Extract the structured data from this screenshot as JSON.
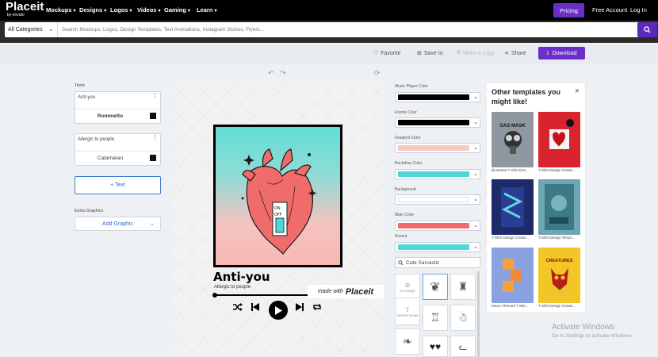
{
  "nav": {
    "logo": "Placeit",
    "logo_sub": "by envato",
    "items": [
      "Mockups",
      "Designs",
      "Logos",
      "Videos",
      "Gaming",
      "Learn"
    ],
    "pricing": "Pricing",
    "create_account": "Free Account",
    "login": "Log In"
  },
  "search": {
    "category": "All Categories",
    "placeholder": "Search Mockups, Logos, Design Templates, Text Animations, Instagram Stories, Flyers..."
  },
  "actions": {
    "favorite": "Favorite",
    "save": "Save to",
    "copy": "Make a copy",
    "share": "Share",
    "download": "Download"
  },
  "left": {
    "texts_label": "Texts",
    "text1": {
      "value": "Anti-you",
      "font": "Rommetto"
    },
    "text2": {
      "value": "Allergic to people",
      "font": "Catamaran"
    },
    "add_text": "+ Text",
    "extra_label": "Extra Graphics",
    "add_graphic": "Add Graphic"
  },
  "design": {
    "title": "Anti-you",
    "subtitle": "Allergic to people",
    "made_with": "made with",
    "made_with_brand": "Placeit",
    "art_labels": {
      "on": "ON",
      "off": "OFF"
    }
  },
  "colors": [
    {
      "label": "Music Player Color",
      "color": "#000000"
    },
    {
      "label": "Frame Color",
      "color": "#000000"
    },
    {
      "label": "Gradient Color",
      "color": "#f7c9c2"
    },
    {
      "label": "Backdrop Color",
      "color": "#4fd6d8"
    },
    {
      "label": "Background",
      "color": "#ffffff"
    },
    {
      "label": "Main Color",
      "color": "#f06c6a"
    },
    {
      "label": "Accent",
      "color": "#4fd6d8"
    }
  ],
  "graphics": {
    "search_value": "Cute Sarcastic",
    "no_image": "No Image",
    "upload_image": "Upload Image"
  },
  "templates": {
    "title": "Other templates you might like!",
    "items": [
      {
        "caption": "Illustrated T-Shirt Des...",
        "art": "GAS MASK",
        "color": "#8f98a0"
      },
      {
        "caption": "T-Shirt Design Creato...",
        "art": "",
        "color": "#d9242e"
      },
      {
        "caption": "T-Shirt Design Creato...",
        "art": "",
        "color": "#1e2a6a"
      },
      {
        "caption": "T-Shirt Design Templ...",
        "art": "",
        "color": "#6ea7b3"
      },
      {
        "caption": "Music-Themed T-Shir...",
        "art": "",
        "color": "#8aa2e0"
      },
      {
        "caption": "T-Shirt Design Creato...",
        "art": "CREATURES",
        "color": "#f2c626"
      }
    ]
  },
  "watermark": {
    "title": "Activate Windows",
    "sub": "Go to Settings to activate Windows."
  }
}
